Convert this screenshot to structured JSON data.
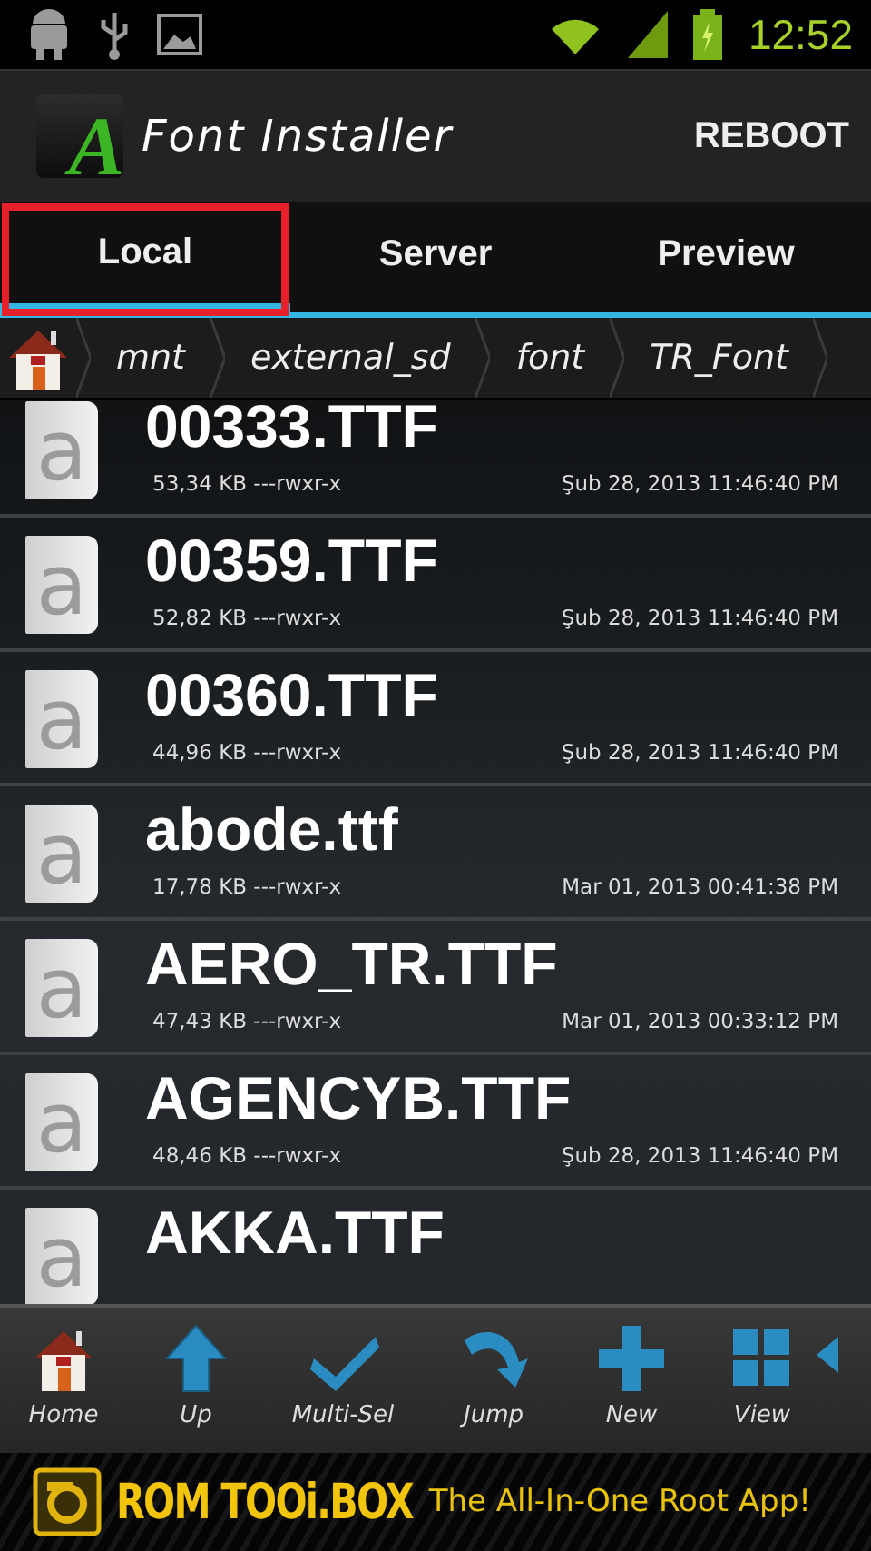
{
  "status_bar": {
    "time": "12:52"
  },
  "app_bar": {
    "logo_letter": "A",
    "title": "Font Installer",
    "action": "REBOOT"
  },
  "tabs": [
    {
      "label": "Local",
      "selected": true,
      "highlighted": true
    },
    {
      "label": "Server",
      "selected": false,
      "highlighted": false
    },
    {
      "label": "Preview",
      "selected": false,
      "highlighted": false
    }
  ],
  "breadcrumb": [
    "mnt",
    "external_sd",
    "font",
    "TR_Font"
  ],
  "files": [
    {
      "icon_glyph": "a",
      "name": "00333.TTF",
      "info": "53,34 KB ---rwxr-x",
      "date": "Şub 28, 2013 11:46:40 PM"
    },
    {
      "icon_glyph": "a",
      "name": "00359.TTF",
      "info": "52,82 KB ---rwxr-x",
      "date": "Şub 28, 2013 11:46:40 PM"
    },
    {
      "icon_glyph": "a",
      "name": "00360.TTF",
      "info": "44,96 KB ---rwxr-x",
      "date": "Şub 28, 2013 11:46:40 PM"
    },
    {
      "icon_glyph": "a",
      "name": "abode.ttf",
      "info": "17,78 KB ---rwxr-x",
      "date": "Mar 01, 2013 00:41:38 PM"
    },
    {
      "icon_glyph": "a",
      "name": "AERO_TR.TTF",
      "info": "47,43 KB ---rwxr-x",
      "date": "Mar 01, 2013 00:33:12 PM"
    },
    {
      "icon_glyph": "a",
      "name": "AGENCYB.TTF",
      "info": "48,46 KB ---rwxr-x",
      "date": "Şub 28, 2013 11:46:40 PM"
    },
    {
      "icon_glyph": "a",
      "name": "AKKA.TTF"
    }
  ],
  "toolbar": [
    {
      "kind": "home",
      "label": "Home"
    },
    {
      "kind": "up",
      "label": "Up"
    },
    {
      "kind": "multiselect",
      "label": "Multi-Sel"
    },
    {
      "kind": "jump",
      "label": "Jump"
    },
    {
      "kind": "new",
      "label": "New"
    },
    {
      "kind": "view",
      "label": "View"
    },
    {
      "kind": "more"
    }
  ],
  "banner": {
    "brand": "ROM TOOi.BOX",
    "tagline": "The All-In-One Root App!"
  }
}
